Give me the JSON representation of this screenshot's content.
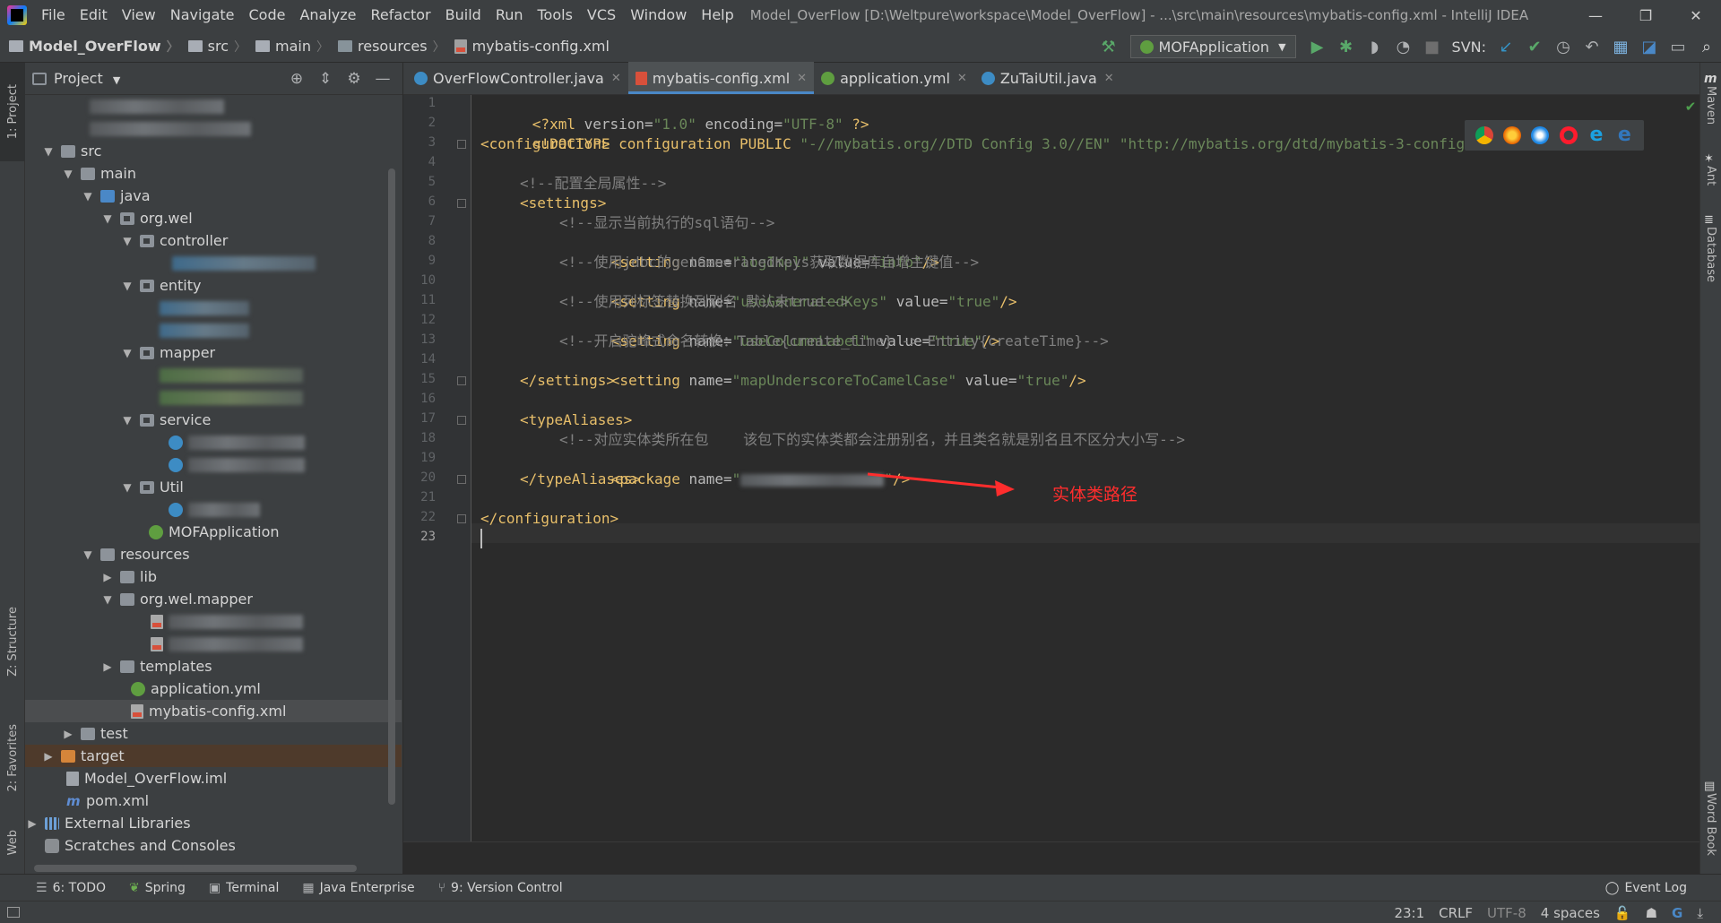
{
  "menubar": {
    "items": [
      "File",
      "Edit",
      "View",
      "Navigate",
      "Code",
      "Analyze",
      "Refactor",
      "Build",
      "Run",
      "Tools",
      "VCS",
      "Window",
      "Help"
    ],
    "title": "Model_OverFlow [D:\\Weltpure\\workspace\\Model_OverFlow] - ...\\src\\main\\resources\\mybatis-config.xml - IntelliJ IDEA",
    "controls": [
      "—",
      "❐",
      "✕"
    ]
  },
  "breadcrumb": [
    "Model_OverFlow",
    "src",
    "main",
    "resources",
    "mybatis-config.xml"
  ],
  "toolbar": {
    "run_config": "MOFApplication",
    "svn_label": "SVN:",
    "colors": {
      "run": "#59a869",
      "debug": "#59a869",
      "svn_update": "#3592c4",
      "svn_commit": "#59a869"
    }
  },
  "left_stripe": {
    "project": "1: Project",
    "structure": "Z: Structure",
    "favorites": "2: Favorites",
    "web": "Web"
  },
  "right_stripe": {
    "maven": "Maven",
    "ant": "Ant",
    "database": "Database",
    "wordbook": "Word Book"
  },
  "project_panel": {
    "title": "Project",
    "tree": {
      "src": "src",
      "main": "main",
      "java": "java",
      "pkg": "org.wel",
      "controller": "controller",
      "entity": "entity",
      "mapper": "mapper",
      "service": "service",
      "util": "Util",
      "mof_app": "MOFApplication",
      "resources": "resources",
      "lib": "lib",
      "mapper_pkg": "org.wel.mapper",
      "templates": "templates",
      "app_yml": "application.yml",
      "mybatis": "mybatis-config.xml",
      "test": "test",
      "target": "target",
      "iml": "Model_OverFlow.iml",
      "pom": "pom.xml",
      "ext_libs": "External Libraries",
      "scratches": "Scratches and Consoles"
    }
  },
  "tabs": [
    {
      "label": "OverFlowController.java",
      "color": "#3d8cc4"
    },
    {
      "label": "mybatis-config.xml",
      "color": "#d8503b",
      "active": true
    },
    {
      "label": "application.yml",
      "color": "#5f9e40"
    },
    {
      "label": "ZuTaiUtil.java",
      "color": "#3d8cc4"
    }
  ],
  "code": {
    "l1": {
      "a": "<?xml ",
      "b": "version=",
      "c": "\"1.0\"",
      "d": " encoding=",
      "e": "\"UTF-8\"",
      "f": " ?>"
    },
    "l2": {
      "a": "<!DOCTYPE configuration PUBLIC ",
      "b": "\"-//mybatis.org//DTD Config 3.0//EN\"",
      "c": " ",
      "d": "\"http://mybatis.org/dtd/mybatis-3-config.dtd\"",
      "e": ">"
    },
    "l3": "<configuration>",
    "l5": "<!--配置全局属性-->",
    "l6": "<settings>",
    "l7": "<!--显示当前执行的sql语句-->",
    "l8": {
      "a": "<setting ",
      "b": "name=",
      "c": "\"logImpl\"",
      "d": " value=",
      "e": "\"info\"",
      "f": "/>"
    },
    "l9": "<!--使用jdbc的getGeneratedKeys获取数据库自增主键值-->",
    "l10": {
      "a": "<setting ",
      "b": "name=",
      "c": "\"useGeneratedKeys\"",
      "d": " value=",
      "e": "\"true\"",
      "f": "/>"
    },
    "l11": "<!--使用列标签替换列别名 默认未true-->",
    "l12": {
      "a": "<setting ",
      "b": "name=",
      "c": "\"useColumnLabel\"",
      "d": " value=",
      "e": "\"true\"",
      "f": "/>"
    },
    "l13": "<!--开启驼峰式命名转换：Table{create_time} -> Entity{createTime}-->",
    "l14": {
      "a": "<setting ",
      "b": "name=",
      "c": "\"mapUnderscoreToCamelCase\"",
      "d": " value=",
      "e": "\"true\"",
      "f": "/>"
    },
    "l15": "</settings>",
    "l17": "<typeAliases>",
    "l18": "<!--对应实体类所在包    该包下的实体类都会注册别名，并且类名就是别名且不区分大小写-->",
    "l19": {
      "a": "<package ",
      "b": "name=",
      "c": "\"",
      "e": "\"",
      "f": "/>"
    },
    "l20": "</typeAliases>",
    "l22": "</configuration>"
  },
  "annotation": {
    "text": "实体类路径",
    "color": "#ff2d2d"
  },
  "bottom_tools": {
    "todo": "6: TODO",
    "spring": "Spring",
    "terminal": "Terminal",
    "java_ee": "Java Enterprise",
    "vcs": "9: Version Control",
    "event_log": "Event Log"
  },
  "status": {
    "position": "23:1",
    "line_sep": "CRLF",
    "encoding": "UTF-8",
    "indent": "4 spaces"
  }
}
